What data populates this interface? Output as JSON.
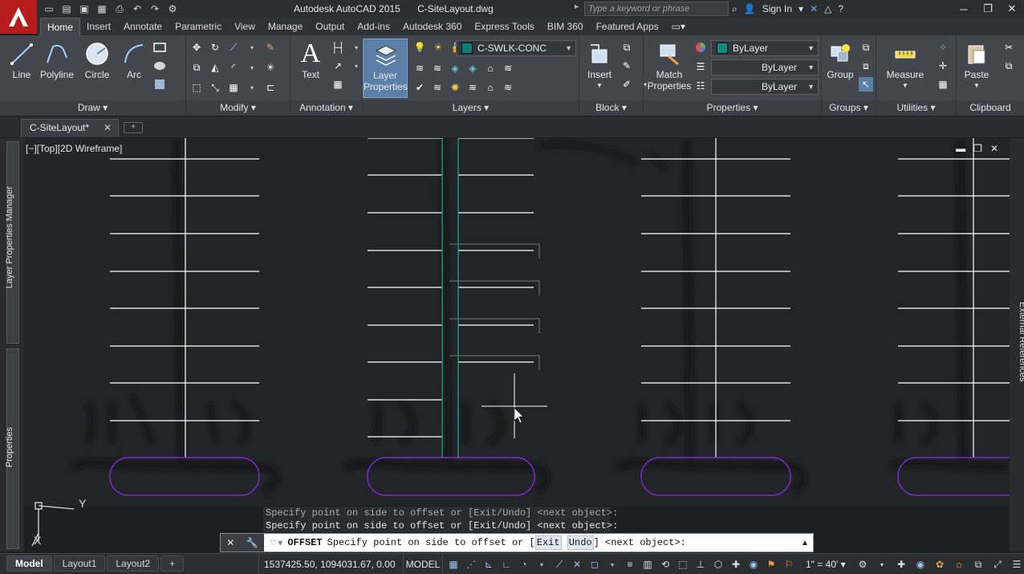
{
  "titlebar": {
    "app_name": "Autodesk AutoCAD 2015",
    "file_name": "C-SiteLayout.dwg",
    "search_placeholder": "Type a keyword or phrase",
    "sign_in": "Sign In"
  },
  "ribbon": {
    "tabs": [
      "Home",
      "Insert",
      "Annotate",
      "Parametric",
      "View",
      "Manage",
      "Output",
      "Add-ins",
      "Autodesk 360",
      "Express Tools",
      "BIM 360",
      "Featured Apps"
    ],
    "active_tab": "Home",
    "draw": {
      "title": "Draw",
      "line": "Line",
      "polyline": "Polyline",
      "circle": "Circle",
      "arc": "Arc"
    },
    "modify": {
      "title": "Modify"
    },
    "annotation": {
      "title": "Annotation",
      "text": "Text"
    },
    "layers": {
      "title": "Layers",
      "layer_properties": "Layer Properties",
      "current_layer": "C-SWLK-CONC",
      "layer_color": "#0e7d73"
    },
    "block": {
      "title": "Block",
      "insert": "Insert"
    },
    "properties": {
      "title": "Properties",
      "match_properties": "Match Properties",
      "color": "ByLayer",
      "color_swatch": "#0e8a80",
      "linetype": "ByLayer",
      "lineweight": "ByLayer"
    },
    "groups": {
      "title": "Groups",
      "group": "Group"
    },
    "utilities": {
      "title": "Utilities",
      "measure": "Measure"
    },
    "clipboard": {
      "title": "Clipboard",
      "paste": "Paste"
    }
  },
  "file_tabs": {
    "active": "C-SiteLayout*"
  },
  "palettes": {
    "left_top": "Layer Properties Manager",
    "left_bottom": "Properties",
    "right": "External References"
  },
  "viewport": {
    "label": "[−][Top][2D Wireframe]"
  },
  "command": {
    "history": [
      "Specify point on side to offset or [Exit/Undo] <next object>:",
      "Specify point on side to offset or [Exit/Undo] <next object>:"
    ],
    "name": "OFFSET",
    "prompt_pre": "Specify point on side to offset or [",
    "opt_exit": "Exit",
    "opt_undo": "Undo",
    "prompt_post": "] <next object>:"
  },
  "status": {
    "layout_tabs": [
      "Model",
      "Layout1",
      "Layout2"
    ],
    "coordinates": "1537425.50, 1094031.67, 0.00",
    "space": "MODEL",
    "scale": "1\" = 40'"
  },
  "colors": {
    "parking_lines": "#ffffff",
    "island": "#7d2ad6",
    "sidewalk": "#1ca59a",
    "cursor": "#ffffff"
  }
}
